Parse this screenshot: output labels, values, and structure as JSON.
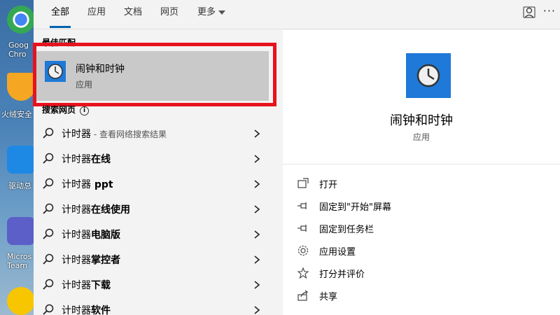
{
  "desktop": {
    "icons": [
      {
        "label": "Goog\nChro",
        "color": "#e94235"
      },
      {
        "label": "火绒安全",
        "color": "#f5a623"
      },
      {
        "label": "驱动总",
        "color": "#1e88e5"
      },
      {
        "label": "Micros\nTeam",
        "color": "#5b5fc7"
      },
      {
        "label": "",
        "color": "#f7c600"
      }
    ]
  },
  "tabs": [
    {
      "label": "全部",
      "active": true
    },
    {
      "label": "应用"
    },
    {
      "label": "文档"
    },
    {
      "label": "网页"
    },
    {
      "label": "更多"
    }
  ],
  "best_match": {
    "section_title": "最佳匹配",
    "name": "闹钟和时钟",
    "type": "应用"
  },
  "web_search": {
    "section_title": "搜索网页",
    "results": [
      {
        "prefix": "计时器",
        "suffix": " - 查看网络搜索结果"
      },
      {
        "prefix": "计时器",
        "bold": "在线"
      },
      {
        "prefix": "计时器",
        "bold": " ppt"
      },
      {
        "prefix": "计时器",
        "bold": "在线使用"
      },
      {
        "prefix": "计时器",
        "bold": "电脑版"
      },
      {
        "prefix": "计时器",
        "bold": "掌控者"
      },
      {
        "prefix": "计时器",
        "bold": "下载"
      },
      {
        "prefix": "计时器",
        "bold": "软件"
      }
    ]
  },
  "details": {
    "name": "闹钟和时钟",
    "type": "应用",
    "actions": [
      {
        "label": "打开",
        "icon": "open-icon"
      },
      {
        "label": "固定到\"开始\"屏幕",
        "icon": "pin-icon"
      },
      {
        "label": "固定到任务栏",
        "icon": "pin-icon"
      },
      {
        "label": "应用设置",
        "icon": "gear-icon"
      },
      {
        "label": "打分并评价",
        "icon": "star-icon"
      },
      {
        "label": "共享",
        "icon": "share-icon"
      }
    ]
  },
  "colors": {
    "highlight_border": "#e8121d",
    "app_icon_bg": "#1e79d8",
    "accent": "#0063b1"
  }
}
